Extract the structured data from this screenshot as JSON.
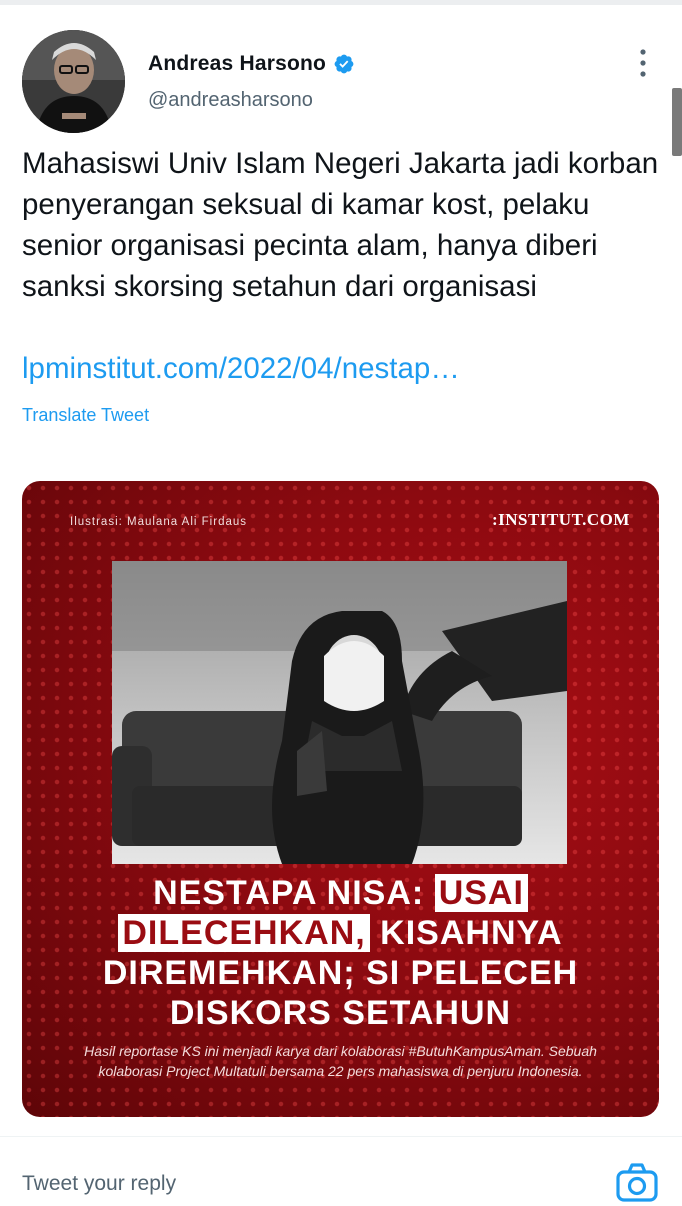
{
  "author": {
    "name": "Andreas Harsono",
    "handle": "@andreasharsono"
  },
  "tweet": {
    "text": "Mahasiswi Univ Islam Negeri Jakarta jadi korban penyerangan seksual di kamar kost, pelaku senior organisasi pecinta alam, hanya diberi sanksi skorsing setahun dari organisasi",
    "link": "lpminstitut.com/2022/04/nestap…",
    "translate_label": "Translate Tweet"
  },
  "card": {
    "credit": "Ilustrasi: Maulana Ali Firdaus",
    "brand": ":INSTITUT.COM",
    "headline": {
      "part1": "NESTAPA NISA: ",
      "highlight1": "USAI",
      "highlight2": "DILECEHKAN,",
      "part2": " KISAHNYA",
      "line3": "DIREMEHKAN; SI PELECEH",
      "line4": "DISKORS SETAHUN"
    },
    "caption": "Hasil reportase KS ini menjadi karya dari kolaborasi #ButuhKampusAman. Sebuah kolaborasi Project Multatuli bersama 22 pers mahasiswa di penjuru Indonesia."
  },
  "reply": {
    "placeholder": "Tweet your reply"
  },
  "colors": {
    "accent": "#1d9bf0",
    "card_red": "#8c0a10"
  }
}
